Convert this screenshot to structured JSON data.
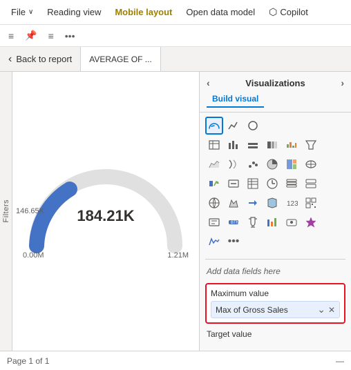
{
  "menubar": {
    "items": [
      {
        "label": "File",
        "has_arrow": true,
        "active": false
      },
      {
        "label": "Reading view",
        "active": false
      },
      {
        "label": "Mobile layout",
        "active": true
      },
      {
        "label": "Open data model",
        "active": false
      },
      {
        "label": "Copilot",
        "active": false,
        "has_icon": true
      }
    ]
  },
  "toolbar": {
    "icons": [
      "≡",
      "📌",
      "≡",
      "..."
    ]
  },
  "tabs": {
    "back_label": "Back to report",
    "active_tab": "AVERAGE OF ..."
  },
  "filters": {
    "label": "Filters"
  },
  "gauge": {
    "value": "184.21K",
    "min": "0.00M",
    "max": "1.21M",
    "side_label": "146.65K"
  },
  "visualizations": {
    "title": "Visualizations",
    "nav_left": "‹",
    "nav_right": "›",
    "tabs": [
      {
        "label": "Build visual",
        "active": true
      },
      {
        "label": "",
        "active": false
      }
    ],
    "sections": {
      "add_data_label": "Add data fields here",
      "maximum_value": {
        "label": "Maximum value",
        "field": "Max of Gross Sales"
      },
      "target_value": {
        "label": "Target value"
      }
    }
  },
  "statusbar": {
    "page_info": "Page 1 of 1"
  }
}
